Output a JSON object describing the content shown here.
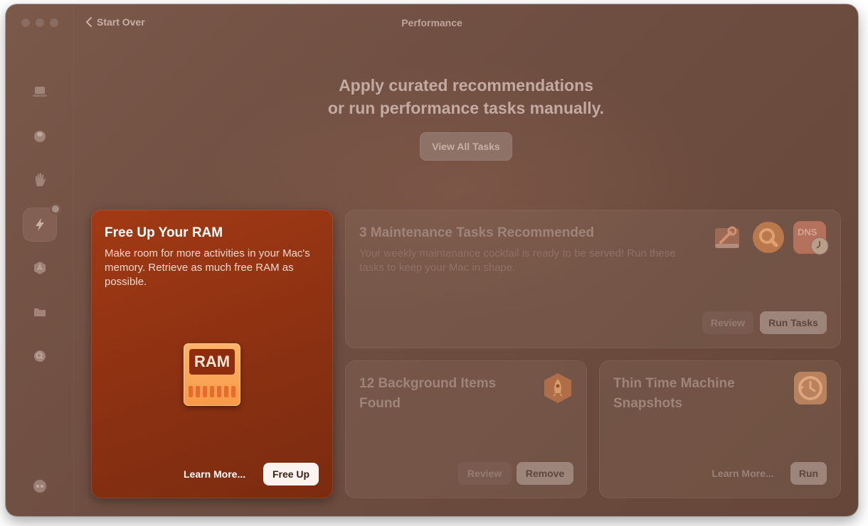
{
  "window": {
    "title": "Performance"
  },
  "nav": {
    "back_label": "Start Over"
  },
  "sidebar": {
    "items": [
      {
        "name": "smart-care",
        "icon": "laptop-icon"
      },
      {
        "name": "cleanup",
        "icon": "disk-icon"
      },
      {
        "name": "protection",
        "icon": "hand-icon"
      },
      {
        "name": "performance",
        "icon": "bolt-icon",
        "active": true
      },
      {
        "name": "applications",
        "icon": "apps-icon"
      },
      {
        "name": "my-clutter",
        "icon": "folder-icon"
      },
      {
        "name": "space-lens",
        "icon": "lens-icon"
      }
    ],
    "bottom": {
      "icon": "assistant-icon"
    }
  },
  "header": {
    "line1": "Apply curated recommendations",
    "line2": "or run performance tasks manually.",
    "view_all_label": "View All Tasks"
  },
  "featured": {
    "title": "Free Up Your RAM",
    "description": "Make room for more activities in your Mac's memory. Retrieve as much free RAM as possible.",
    "icon_label": "RAM",
    "learn_more_label": "Learn More...",
    "action_label": "Free Up"
  },
  "maintenance": {
    "title": "3 Maintenance Tasks Recommended",
    "description": "Your weekly maintenance cocktail is ready to be served! Run these tasks to keep your Mac in shape.",
    "icon_dns_label": "DNS",
    "review_label": "Review",
    "action_label": "Run Tasks"
  },
  "background": {
    "title": "12 Background Items Found",
    "review_label": "Review",
    "action_label": "Remove"
  },
  "time_machine": {
    "title": "Thin Time Machine Snapshots",
    "learn_more_label": "Learn More...",
    "action_label": "Run"
  },
  "colors": {
    "featured_bg": "#8f3212",
    "window_bg": "#6e4e41",
    "primary_button": "#fbf3ef"
  }
}
